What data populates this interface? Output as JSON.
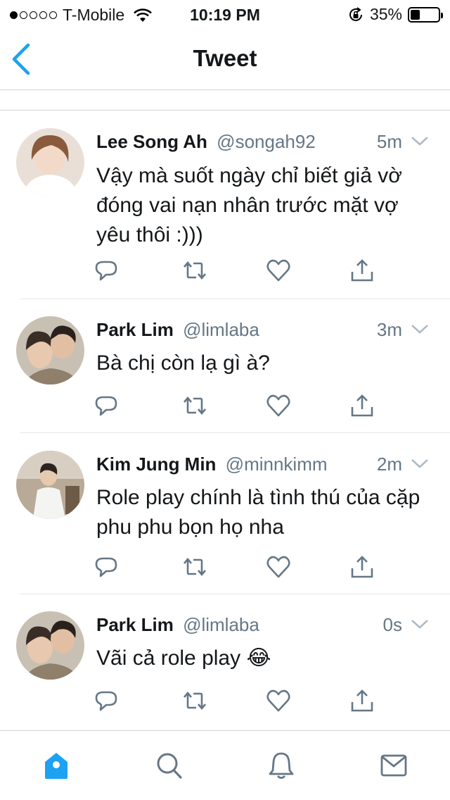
{
  "status_bar": {
    "carrier": "T-Mobile",
    "time": "10:19 PM",
    "battery": "35%",
    "battery_level": 0.35,
    "signal_bars": 1
  },
  "nav": {
    "title": "Tweet"
  },
  "tweets": [
    {
      "name": "Lee Song Ah",
      "handle": "@songah92",
      "time": "5m",
      "text": "Vậy mà suốt ngày chỉ biết giả vờ đóng vai nạn nhân trước mặt vợ yêu thôi :)))"
    },
    {
      "name": "Park Lim",
      "handle": "@limlaba",
      "time": "3m",
      "text": "Bà chị còn lạ gì à?"
    },
    {
      "name": "Kim Jung Min",
      "handle": "@minnkimm",
      "time": "2m",
      "text": "Role play chính là tình thú của cặp phu phu bọn họ nha"
    },
    {
      "name": "Park Lim",
      "handle": "@limlaba",
      "time": "0s",
      "text": "Vãi cả role play 😂"
    }
  ],
  "colors": {
    "accent": "#1da1f2",
    "icon": "#657786",
    "divider": "#e1e8ed"
  },
  "icons": {
    "actions": [
      "reply-icon",
      "retweet-icon",
      "like-icon",
      "share-icon"
    ],
    "tabs": [
      "home-icon",
      "search-icon",
      "notifications-icon",
      "messages-icon"
    ]
  }
}
